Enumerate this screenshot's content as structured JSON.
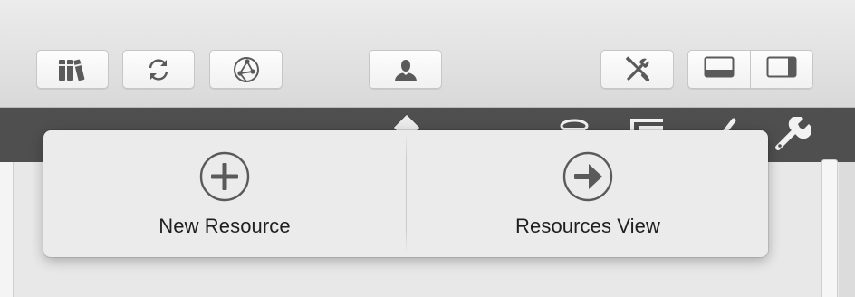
{
  "toolbar": {
    "buttons": [
      {
        "name": "library",
        "icon": "books-icon"
      },
      {
        "name": "sync",
        "icon": "sync-icon"
      },
      {
        "name": "network",
        "icon": "network-icon"
      },
      {
        "name": "resources",
        "icon": "person-icon"
      },
      {
        "name": "tools",
        "icon": "tools-icon"
      }
    ],
    "layout_toggle": [
      {
        "name": "bottom-panel",
        "icon": "bottom-panel-icon"
      },
      {
        "name": "right-panel",
        "icon": "right-panel-icon"
      }
    ]
  },
  "background_bar_icons": [
    "filter-icon",
    "list-icon",
    "checkmark-icon",
    "wrench-icon"
  ],
  "popover": {
    "items": [
      {
        "label": "New Resource",
        "icon": "plus-circle-icon"
      },
      {
        "label": "Resources View",
        "icon": "arrow-right-circle-icon"
      }
    ]
  },
  "colors": {
    "toolbar_bg": "#e0e0e0",
    "dark_bar": "#4f4f4f",
    "popover_bg": "#ebebeb",
    "icon_gray": "#5a5a5a"
  }
}
